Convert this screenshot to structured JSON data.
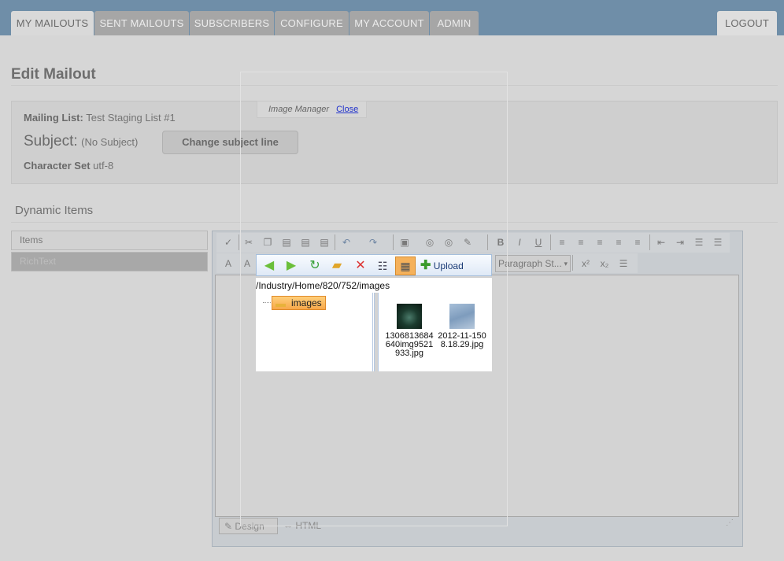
{
  "nav": {
    "tabs": [
      {
        "label": "MY MAILOUTS"
      },
      {
        "label": "SENT MAILOUTS"
      },
      {
        "label": "SUBSCRIBERS"
      },
      {
        "label": "CONFIGURE"
      },
      {
        "label": "MY ACCOUNT"
      },
      {
        "label": "ADMIN"
      }
    ],
    "logout": "LOGOUT"
  },
  "page": {
    "title": "Edit Mailout"
  },
  "details": {
    "mailing_list_label": "Mailing List:",
    "mailing_list_value": "Test Staging List #1",
    "subject_label": "Subject:",
    "subject_value": "(No Subject)",
    "change_subject_button": "Change subject line",
    "charset_label": "Character Set",
    "charset_value": "utf-8"
  },
  "dynamic": {
    "title": "Dynamic Items",
    "items": [
      {
        "label": "Items"
      },
      {
        "label": "RichText"
      }
    ]
  },
  "editor": {
    "paragraph_style": "Paragraph St...",
    "modes": {
      "design": "Design",
      "html": "HTML"
    }
  },
  "image_manager": {
    "title": "Image Manager",
    "close": "Close",
    "upload": "Upload",
    "path": "/Industry/Home/820/752/images",
    "folder": "images",
    "files": [
      {
        "name": "1306813684640img9521933.jpg"
      },
      {
        "name": "2012-11-1508.18.29.jpg"
      }
    ]
  }
}
